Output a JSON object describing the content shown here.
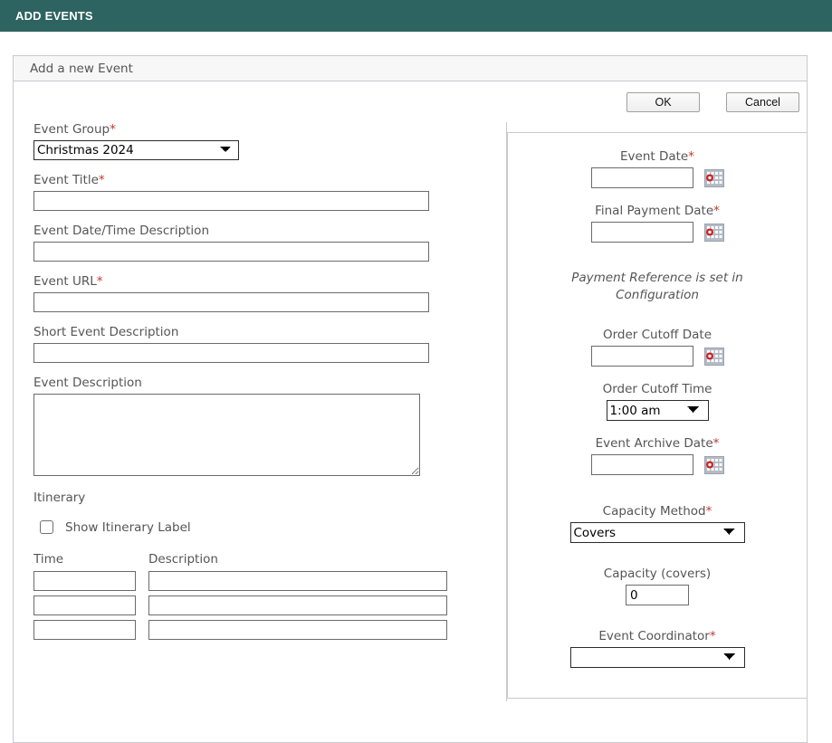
{
  "topbar": {
    "title": "ADD EVENTS"
  },
  "panel": {
    "title": "Add a new Event"
  },
  "actions": {
    "ok_label": "OK",
    "cancel_label": "Cancel"
  },
  "left_column": {
    "event_group": {
      "label": "Event Group",
      "required": "*",
      "value": "Christmas 2024",
      "options": [
        "Christmas 2024"
      ]
    },
    "event_title": {
      "label": "Event Title",
      "required": "*",
      "value": ""
    },
    "event_datetime_description": {
      "label": "Event Date/Time Description",
      "value": ""
    },
    "event_url": {
      "label": "Event URL",
      "required": "*",
      "value": ""
    },
    "short_event_description": {
      "label": "Short Event Description",
      "value": ""
    },
    "event_description": {
      "label": "Event Description",
      "value": ""
    },
    "itinerary": {
      "heading": "Itinerary",
      "show_label_checkbox": {
        "label": "Show Itinerary Label",
        "checked": false
      },
      "columns": {
        "time": "Time",
        "description": "Description"
      },
      "rows": [
        {
          "time": "",
          "description": ""
        },
        {
          "time": "",
          "description": ""
        },
        {
          "time": "",
          "description": ""
        }
      ]
    }
  },
  "right_column": {
    "event_date": {
      "label": "Event Date",
      "required": "*",
      "value": "",
      "icon": "calendar-icon"
    },
    "final_payment_date": {
      "label": "Final Payment Date",
      "required": "*",
      "value": "",
      "icon": "calendar-icon"
    },
    "payment_reference_note": "Payment Reference is set in Configuration",
    "order_cutoff_date": {
      "label": "Order Cutoff Date",
      "value": "",
      "icon": "calendar-icon"
    },
    "order_cutoff_time": {
      "label": "Order Cutoff Time",
      "value": "1:00 am",
      "options": [
        "1:00 am"
      ]
    },
    "event_archive_date": {
      "label": "Event Archive Date",
      "required": "*",
      "value": "",
      "icon": "calendar-icon"
    },
    "capacity_method": {
      "label": "Capacity Method",
      "required": "*",
      "value": "Covers",
      "options": [
        "Covers"
      ]
    },
    "capacity_covers": {
      "label": "Capacity (covers)",
      "value": "0"
    },
    "event_coordinator": {
      "label": "Event Coordinator",
      "required": "*",
      "value": "",
      "options": [
        ""
      ]
    }
  },
  "colors": {
    "header_teal": "#2d6360",
    "required_red": "#c0392b",
    "label_gray": "#555555",
    "border_gray": "#c9c9d1",
    "calendar_icon_bg": "#b5bcc6",
    "calendar_icon_accent": "#cc2222"
  }
}
